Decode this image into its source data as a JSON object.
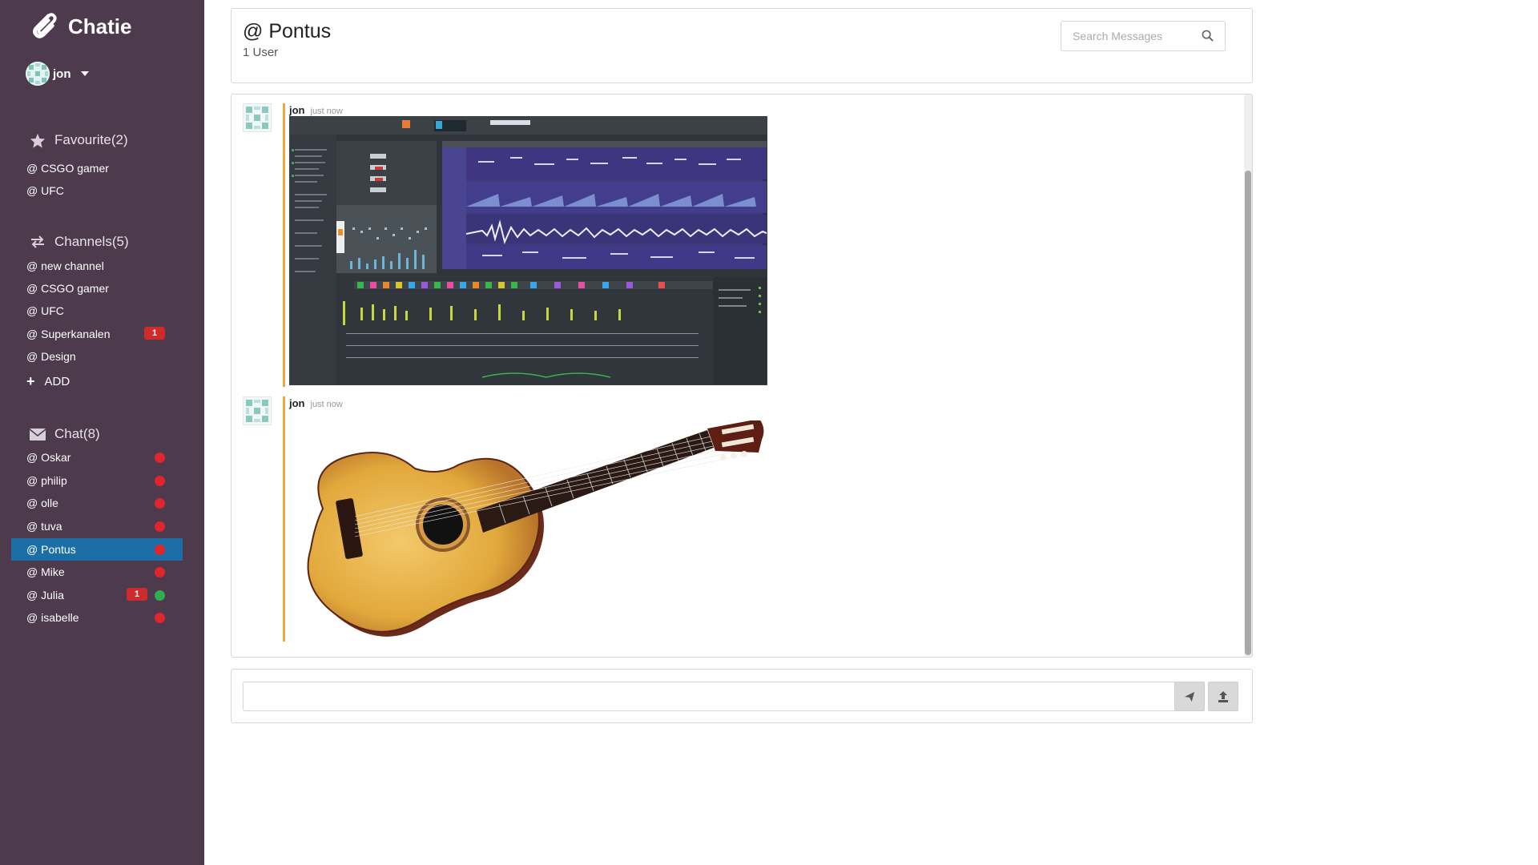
{
  "app": {
    "name": "Chatie"
  },
  "user": {
    "name": "jon"
  },
  "sidebar": {
    "favourites": {
      "title": "Favourite(2)",
      "items": [
        {
          "label": "@ CSGO gamer"
        },
        {
          "label": "@ UFC"
        }
      ]
    },
    "channels": {
      "title": "Channels(5)",
      "items": [
        {
          "label": "@ new channel"
        },
        {
          "label": "@ CSGO gamer"
        },
        {
          "label": "@ UFC"
        },
        {
          "label": "@ Superkanalen",
          "badge": "1"
        },
        {
          "label": "@ Design"
        }
      ],
      "add_label": "ADD"
    },
    "chat": {
      "title": "Chat(8)",
      "items": [
        {
          "label": "@ Oskar",
          "status": "offline"
        },
        {
          "label": "@ philip",
          "status": "offline"
        },
        {
          "label": "@ olle",
          "status": "offline"
        },
        {
          "label": "@ tuva",
          "status": "offline"
        },
        {
          "label": "@ Pontus",
          "status": "offline",
          "active": true
        },
        {
          "label": "@ Mike",
          "status": "offline"
        },
        {
          "label": "@ Julia",
          "status": "online",
          "badge": "1"
        },
        {
          "label": "@ isabelle",
          "status": "offline"
        }
      ]
    }
  },
  "room": {
    "title": "@ Pontus",
    "subtitle": "1 User"
  },
  "search": {
    "placeholder": "Search Messages"
  },
  "messages": [
    {
      "user": "jon",
      "time": "just now",
      "attachment": "daw-screenshot-image"
    },
    {
      "user": "jon",
      "time": "just now",
      "attachment": "acoustic-guitar-image"
    }
  ],
  "composer": {
    "placeholder": ""
  },
  "colors": {
    "sidebar": "#4d3a4c",
    "active_item": "#1b6ea6",
    "badge": "#d02b2b",
    "offline_dot": "#e0262c",
    "online_dot": "#2fb04a",
    "message_accent": "#f0a534"
  }
}
